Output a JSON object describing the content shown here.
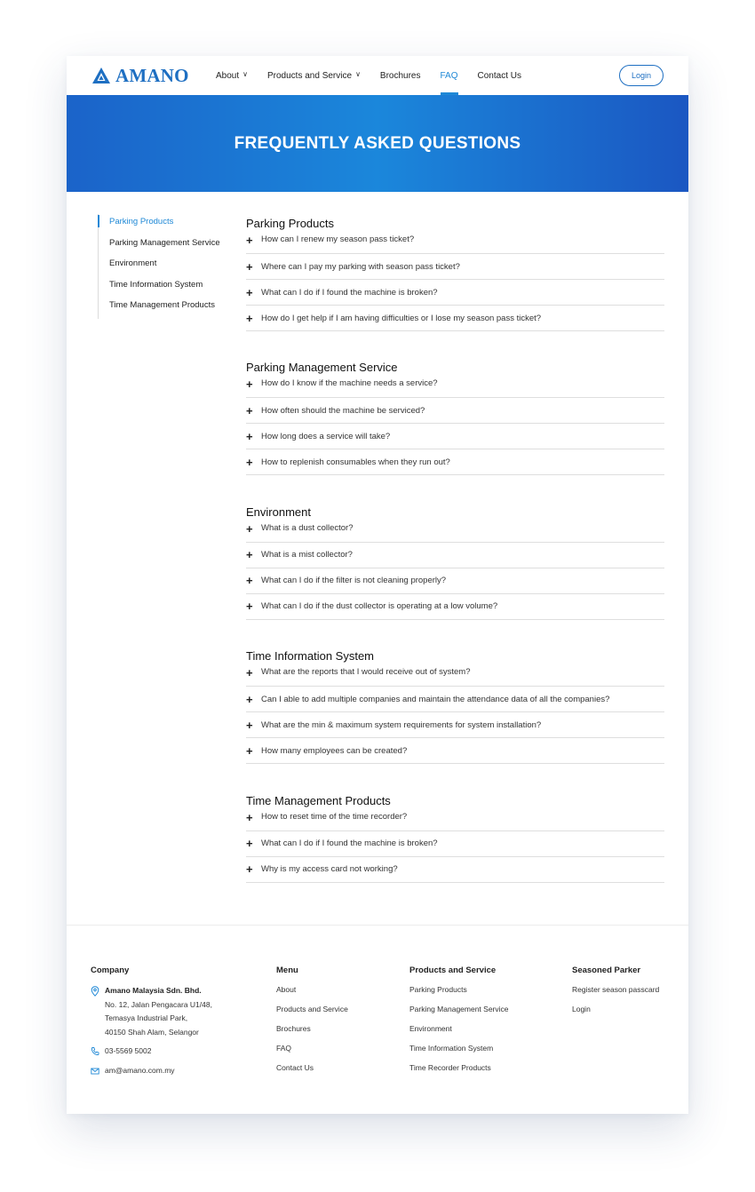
{
  "brand": {
    "logo_text": "AMANO",
    "accent": "#1e88d6",
    "logo_color": "#1e6fc2"
  },
  "nav": {
    "items": [
      {
        "label": "About",
        "has_dropdown": true
      },
      {
        "label": "Products and Service",
        "has_dropdown": true
      },
      {
        "label": "Brochures",
        "has_dropdown": false
      },
      {
        "label": "FAQ",
        "has_dropdown": false,
        "active": true
      },
      {
        "label": "Contact Us",
        "has_dropdown": false
      }
    ],
    "login_label": "Login"
  },
  "hero": {
    "title": "FREQUENTLY ASKED QUESTIONS"
  },
  "sidebar": {
    "items": [
      {
        "label": "Parking Products",
        "active": true
      },
      {
        "label": "Parking Management Service"
      },
      {
        "label": "Environment"
      },
      {
        "label": "Time Information System"
      },
      {
        "label": "Time Management Products"
      }
    ]
  },
  "faq": {
    "sections": [
      {
        "title": "Parking Products",
        "questions": [
          "How can I renew my season pass ticket?",
          "Where can I pay my parking with season pass ticket?",
          "What can I do if I found the machine is broken?",
          "How do I get help if I am having difficulties or I lose my season pass ticket?"
        ]
      },
      {
        "title": "Parking Management Service",
        "questions": [
          "How do I know if the machine needs a service?",
          "How often should the machine be serviced?",
          "How long does a service will take?",
          "How to replenish consumables when they run out?"
        ]
      },
      {
        "title": "Environment",
        "questions": [
          "What is a dust collector?",
          "What is a mist collector?",
          "What can I do if the filter is not cleaning properly?",
          "What can I do if the dust collector is operating at a low volume?"
        ]
      },
      {
        "title": "Time Information System",
        "questions": [
          "What are the reports that I would receive out of system?",
          "Can I able to add multiple companies and maintain the attendance data of all the companies?",
          "What are the min & maximum system requirements for system installation?",
          "How many employees can be created?"
        ]
      },
      {
        "title": "Time Management Products",
        "questions": [
          "How to reset time of the time recorder?",
          "What can I do if I found the machine is broken?",
          "Why is my access card not working?"
        ]
      }
    ]
  },
  "footer": {
    "company": {
      "heading": "Company",
      "name": "Amano Malaysia Sdn. Bhd.",
      "address_lines": [
        "No. 12, Jalan Pengacara U1/48,",
        "Temasya Industrial Park,",
        "40150 Shah Alam, Selangor"
      ],
      "phone": "03-5569 5002",
      "email": "am@amano.com.my"
    },
    "menu": {
      "heading": "Menu",
      "links": [
        "About",
        "Products and Service",
        "Brochures",
        "FAQ",
        "Contact Us"
      ]
    },
    "products": {
      "heading": "Products and Service",
      "links": [
        "Parking Products",
        "Parking Management Service",
        "Environment",
        "Time Information System",
        "Time Recorder Products"
      ]
    },
    "parker": {
      "heading": "Seasoned Parker",
      "links": [
        "Register season passcard",
        "Login"
      ]
    }
  }
}
